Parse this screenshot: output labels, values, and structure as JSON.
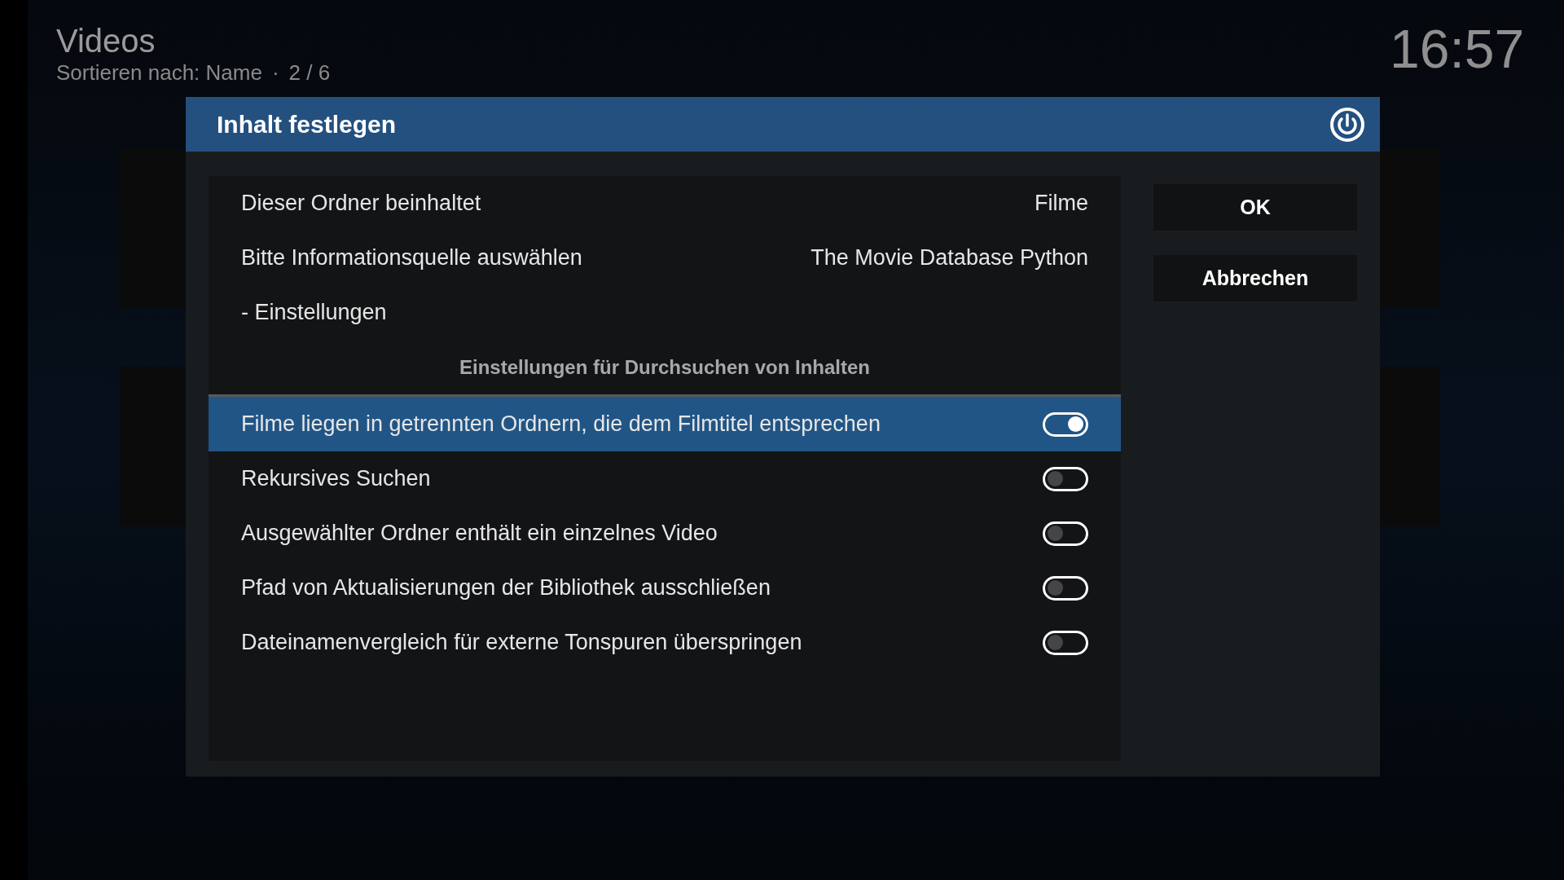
{
  "header": {
    "title": "Videos",
    "subtitle": "Sortieren nach: Name",
    "separator": "·",
    "position": "2 / 6",
    "clock": "16:57"
  },
  "dialog": {
    "title": "Inhalt festlegen",
    "rows": [
      {
        "kind": "value",
        "label": "Dieser Ordner beinhaltet",
        "value": "Filme",
        "selected": false
      },
      {
        "kind": "value",
        "label": "Bitte Informationsquelle auswählen",
        "value": "The Movie Database Python",
        "selected": false
      },
      {
        "kind": "link",
        "label": "- Einstellungen",
        "selected": false
      },
      {
        "kind": "heading",
        "label": "Einstellungen für Durchsuchen von Inhalten"
      },
      {
        "kind": "toggle",
        "label": "Filme liegen in getrennten Ordnern, die dem Filmtitel entsprechen",
        "on": true,
        "selected": true
      },
      {
        "kind": "toggle",
        "label": "Rekursives Suchen",
        "on": false,
        "selected": false
      },
      {
        "kind": "toggle",
        "label": "Ausgewählter Ordner enthält ein einzelnes Video",
        "on": false,
        "selected": false
      },
      {
        "kind": "toggle",
        "label": "Pfad von Aktualisierungen der Bibliothek ausschließen",
        "on": false,
        "selected": false
      },
      {
        "kind": "toggle",
        "label": "Dateinamenvergleich für externe Tonspuren überspringen",
        "on": false,
        "selected": false
      }
    ],
    "buttons": [
      {
        "label": "OK"
      },
      {
        "label": "Abbrechen"
      }
    ]
  }
}
